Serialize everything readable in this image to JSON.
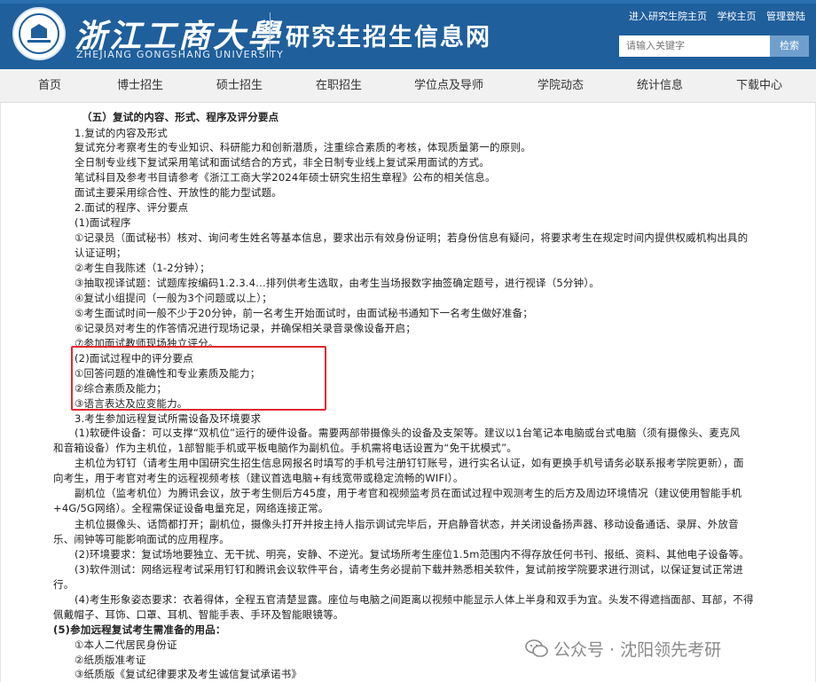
{
  "header": {
    "school_name_cn": "浙江工商大學",
    "school_name_en": "ZHEJIANG GONGSHANG UNIVERSITY",
    "site_title": "研究生招生信息网",
    "top_links": [
      "进入研究生院主页",
      "学校主页",
      "管理登陆"
    ],
    "search_placeholder": "请输入关键字",
    "search_button": "检索"
  },
  "nav": {
    "items": [
      "首页",
      "博士招生",
      "硕士招生",
      "在职招生",
      "学位点及导师",
      "学院动态",
      "统计信息",
      "下载中心"
    ]
  },
  "content": {
    "lines": [
      "（五）复试的内容、形式、程序及评分要点",
      "1.复试的内容及形式",
      "复试充分考察考生的专业知识、科研能力和创新潜质，注重综合素质的考核，体现质量第一的原则。",
      "全日制专业线下复试采用笔试和面试结合的方式，非全日制专业线上复试采用面试的方式。",
      "笔试科目及参考书目请参考《浙江工商大学2024年硕士研究生招生章程》公布的相关信息。",
      "面试主要采用综合性、开放性的能力型试题。",
      "2.面试的程序、评分要点",
      "(1)面试程序",
      "①记录员（面试秘书）核对、询问考生姓名等基本信息，要求出示有效身份证明；若身份信息有疑问，将要求考生在规定时间内提供权威机构出具的",
      "认证证明；",
      "②考生自我陈述（1-2分钟）；",
      "③抽取视译试题：试题库按编码1.2.3.4...排列供考生选取，由考生当场报数字抽签确定题号，进行视译（5分钟）。",
      "④复试小组提问（一般为3个问题或以上）；",
      "⑤考生面试时间一般不少于20分钟，前一名考生开始面试时，由面试秘书通知下一名考生做好准备；",
      "⑥记录员对考生的作答情况进行现场记录，并确保相关录音录像设备开启；",
      "⑦参加面试教师现场独立评分。",
      "(2)面试过程中的评分要点",
      "①回答问题的准确性和专业素质及能力；",
      "②综合素质及能力；",
      "③语言表达及应变能力。",
      "3.考生参加远程复试所需设备及环境要求",
      "(1)软硬件设备：可以支撑“双机位”运行的硬件设备。需要两部带摄像头的设备及支架等。建议以1台笔记本电脑或台式电脑（须有摄像头、麦克风",
      "和音箱设备）作为主机位，1部智能手机或平板电脑作为副机位。手机需将电话设置为“免干扰模式”。",
      "主机位为钉钉（请考生用中国研究生招生信息网报名时填写的手机号注册钉钉账号，进行实名认证，如有更换手机号请务必联系报考学院更新），面",
      "向考生，用于考官对考生的远程视频考核（建议首选电脑+有线宽带或稳定流畅的WIFI）。",
      "副机位（监考机位）为腾讯会议，放于考生侧后方45度，用于考官和视频监考员在面试过程中观测考生的后方及周边环境情况（建议使用智能手机",
      "+4G/5G网络）。全程需保证设备电量充足，网络连接正常。",
      "主机位摄像头、话筒都打开；副机位，摄像头打开并按主持人指示调试完毕后，开启静音状态，并关闭设备扬声器、移动设备通话、录屏、外放音",
      "乐、闹钟等可能影响面试的应用程序。",
      "(2)环境要求：复试场地要独立、无干扰、明亮，安静、不逆光。复试场所考生座位1.5m范围内不得存放任何书刊、报纸、资料、其他电子设备等。",
      "(3)软件测试：网络远程考试采用钉钉和腾讯会议软件平台，请考生务必提前下载并熟悉相关软件，复试前按学院要求进行测试，以保证复试正常进",
      "行。",
      "(4)考生形象姿态要求：衣着得体，全程五官清楚显露。座位与电脑之间距离以视频中能显示人体上半身和双手为宜。头发不得遮挡面部、耳部，不得",
      "佩戴帽子、耳饰、口罩、耳机、智能手表、手环及智能眼镜等。",
      "(5)参加远程复试考生需准备的用品：",
      "①本人二代居民身份证",
      "②纸质版准考证",
      "③纸质版《复试纪律要求及考生诚信复试承诺书》"
    ]
  },
  "watermark": {
    "text": "公众号 · 沈阳领先考研"
  },
  "colors": {
    "header_bg": "#1f5f9c",
    "highlight_box": "#e0292f",
    "nav_bg": "#f1f1f1"
  }
}
